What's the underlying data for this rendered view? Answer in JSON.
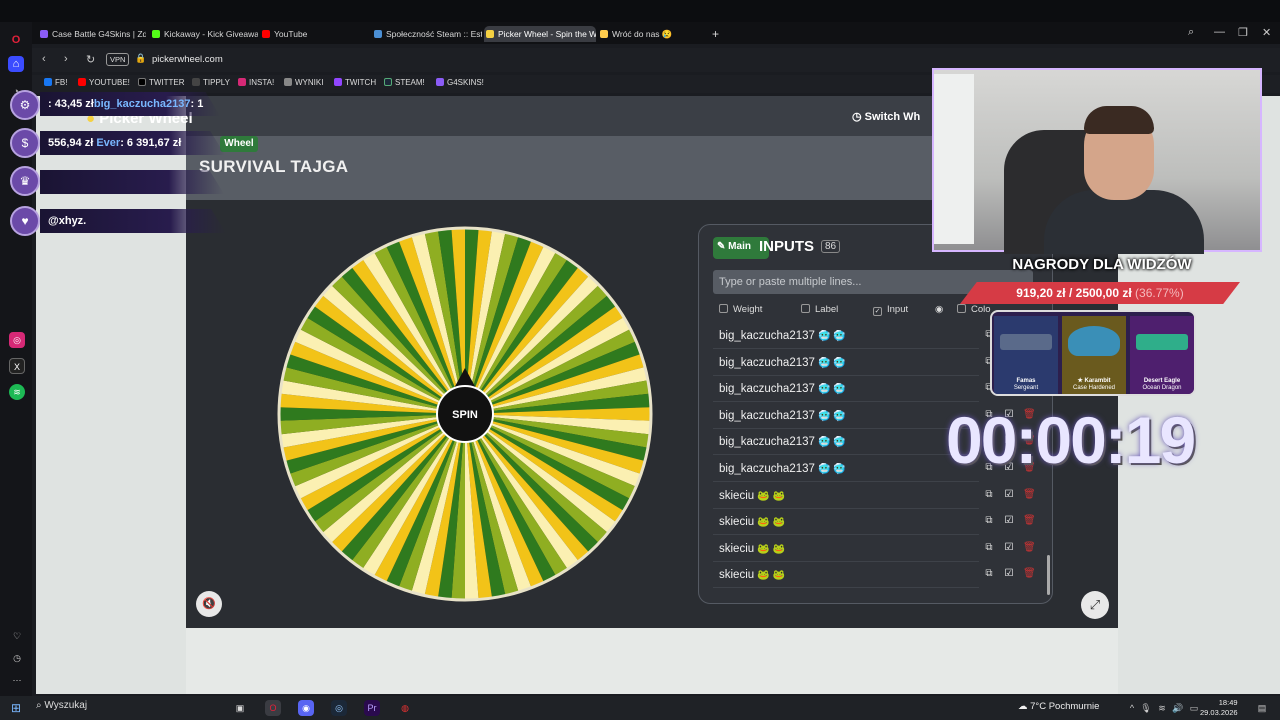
{
  "browser": {
    "tabs": [
      {
        "label": "Case Battle G4Skins | Zdo",
        "color": "#8b5cf6"
      },
      {
        "label": "Kickaway - Kick Giveaway",
        "color": "#53fc18"
      },
      {
        "label": "YouTube",
        "color": "#ff0000"
      },
      {
        "label": "Społeczność Steam :: Esta",
        "color": "#4b8fd4"
      },
      {
        "label": "Picker Wheel - Spin the W",
        "color": "#f5d142"
      },
      {
        "label": "Wróć do nas 😢",
        "color": "#ffcc4d"
      }
    ],
    "vpn": "VPN",
    "url": "pickerwheel.com",
    "bookmarks": [
      {
        "label": "FB!",
        "color": "#1877f2"
      },
      {
        "label": "YOUTUBE!",
        "color": "#ff0000"
      },
      {
        "label": "TWITTER",
        "color": "#000000"
      },
      {
        "label": "TIPPLY",
        "color": "#444444"
      },
      {
        "label": "INSTA!",
        "color": "#d62976"
      },
      {
        "label": "WYNIKI",
        "color": "#888888"
      },
      {
        "label": "TWITCH",
        "color": "#9146ff"
      },
      {
        "label": "STEAM!",
        "color": "#1b2838"
      },
      {
        "label": "G4SKINS!",
        "color": "#8b5cf6"
      }
    ]
  },
  "site": {
    "logo": "Picker Wheel",
    "switch_label": "Switch Wh",
    "wheel_tag": "Wheel",
    "wheel_title": "SURVIVAL TAJGA",
    "spin_label": "SPIN"
  },
  "inputs_panel": {
    "main_label": "Main",
    "title": "INPUTS",
    "count": "86",
    "placeholder": "Type or paste multiple lines...",
    "columns": {
      "weight": "Weight",
      "label": "Label",
      "input": "Input",
      "color": "Colo"
    },
    "rows": [
      {
        "name": "big_kaczucha2137",
        "emoji": "🥶 🥶"
      },
      {
        "name": "big_kaczucha2137",
        "emoji": "🥶 🥶"
      },
      {
        "name": "big_kaczucha2137",
        "emoji": "🥶 🥶"
      },
      {
        "name": "big_kaczucha2137",
        "emoji": "🥶 🥶"
      },
      {
        "name": "big_kaczucha2137",
        "emoji": "🥶 🥶"
      },
      {
        "name": "big_kaczucha2137",
        "emoji": "🥶 🥶"
      },
      {
        "name": "skieciu",
        "emoji": "🐸 🐸"
      },
      {
        "name": "skieciu",
        "emoji": "🐸 🐸"
      },
      {
        "name": "skieciu",
        "emoji": "🐸 🐸"
      },
      {
        "name": "skieciu",
        "emoji": "🐸 🐸"
      }
    ]
  },
  "overlay": {
    "bar1_prefix": ": 43,45 zł",
    "bar1_user": "big_kaczucha2137",
    "bar1_suffix": ": 1",
    "bar2_prefix": "556,94 zł",
    "bar2_user": "Ever",
    "bar2_suffix": ": 6 391,67 zł",
    "bar4": "@xhyz.",
    "prize_title": "NAGRODY DLA WIDZÓW",
    "prize_amount": "919,20 zł / 2500,00 zł",
    "prize_pct": "(36.77%)",
    "prizes": [
      {
        "name": "Famas",
        "sub": "Sergeant",
        "color": "#5a6a8a"
      },
      {
        "name": "★ Karambit",
        "sub": "Case Hardened",
        "color": "#b79a3a"
      },
      {
        "name": "Desert Eagle",
        "sub": "Ocean Dragon",
        "color": "#7a3aa0"
      }
    ],
    "timer": "00:00:19"
  },
  "taskbar": {
    "search": "Wyszukaj",
    "weather": "7°C  Pochmurnie",
    "time": "18:49",
    "date": "29.03.2026"
  }
}
